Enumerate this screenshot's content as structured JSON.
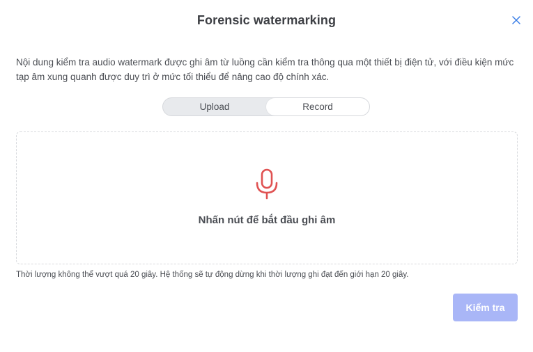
{
  "modal": {
    "title": "Forensic watermarking",
    "description": "Nội dung kiểm tra audio watermark được ghi âm từ luồng cần kiểm tra thông qua một thiết bị điện tử, với điều kiện mức tạp âm xung quanh được duy trì ở mức tối thiểu để nâng cao độ chính xác.",
    "close_icon": "close-icon"
  },
  "mode_toggle": {
    "options": [
      {
        "label": "Upload",
        "selected": false
      },
      {
        "label": "Record",
        "selected": true
      }
    ]
  },
  "record_area": {
    "icon": "microphone-icon",
    "icon_color": "#e05252",
    "hint": "Nhấn nút để bắt đầu ghi âm"
  },
  "duration_note": "Thời lượng không thể vượt quá 20 giây. Hệ thống sẽ tự động dừng khi thời lượng ghi đạt đến giới hạn 20 giây.",
  "actions": {
    "submit_label": "Kiểm tra",
    "submit_enabled": false,
    "submit_color": "#a9b6f7"
  }
}
